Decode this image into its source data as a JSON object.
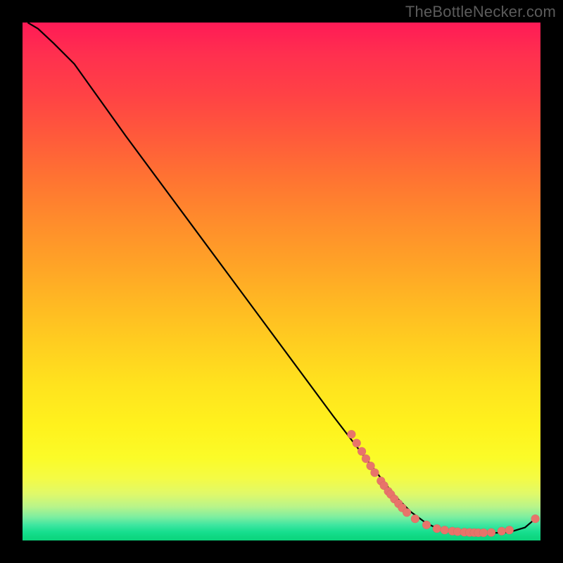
{
  "watermark": "TheBottleNecker.com",
  "chart_data": {
    "type": "line",
    "title": "",
    "xlabel": "",
    "ylabel": "",
    "xlim": [
      0,
      100
    ],
    "ylim": [
      0,
      100
    ],
    "note": "Axes unlabeled in source image; values estimated from pixel positions on a 0–100 scale.",
    "series": [
      {
        "name": "curve",
        "x": [
          1,
          3,
          6,
          10,
          15,
          20,
          30,
          40,
          50,
          60,
          65,
          70,
          72,
          75,
          78,
          80,
          83,
          86,
          90,
          94,
          97,
          99
        ],
        "y": [
          100,
          98.8,
          96,
          92,
          85,
          78,
          64.5,
          51,
          37.5,
          24,
          17.5,
          11,
          8.5,
          5.5,
          3.3,
          2.4,
          1.8,
          1.5,
          1.4,
          1.6,
          2.5,
          4.2
        ]
      }
    ],
    "points": {
      "name": "scatter-points",
      "note": "Coral-colored markers along lower segment of the curve, approximate.",
      "xy": [
        [
          63.5,
          20.5
        ],
        [
          64.5,
          18.8
        ],
        [
          65.5,
          17.2
        ],
        [
          66.3,
          15.8
        ],
        [
          67.2,
          14.4
        ],
        [
          68.0,
          13.1
        ],
        [
          69.2,
          11.5
        ],
        [
          69.8,
          10.6
        ],
        [
          70.6,
          9.5
        ],
        [
          71.1,
          8.9
        ],
        [
          71.8,
          8.0
        ],
        [
          72.6,
          7.1
        ],
        [
          73.3,
          6.3
        ],
        [
          74.2,
          5.4
        ],
        [
          75.8,
          4.2
        ],
        [
          78.0,
          3.0
        ],
        [
          80.0,
          2.3
        ],
        [
          81.5,
          2.0
        ],
        [
          83.0,
          1.8
        ],
        [
          84.0,
          1.7
        ],
        [
          85.3,
          1.6
        ],
        [
          86.3,
          1.55
        ],
        [
          87.2,
          1.52
        ],
        [
          88.0,
          1.5
        ],
        [
          89.0,
          1.5
        ],
        [
          90.5,
          1.55
        ],
        [
          92.5,
          1.8
        ],
        [
          94.0,
          2.0
        ],
        [
          99.0,
          4.2
        ]
      ]
    },
    "marker_color": "#e8746a",
    "line_color": "#000000"
  }
}
